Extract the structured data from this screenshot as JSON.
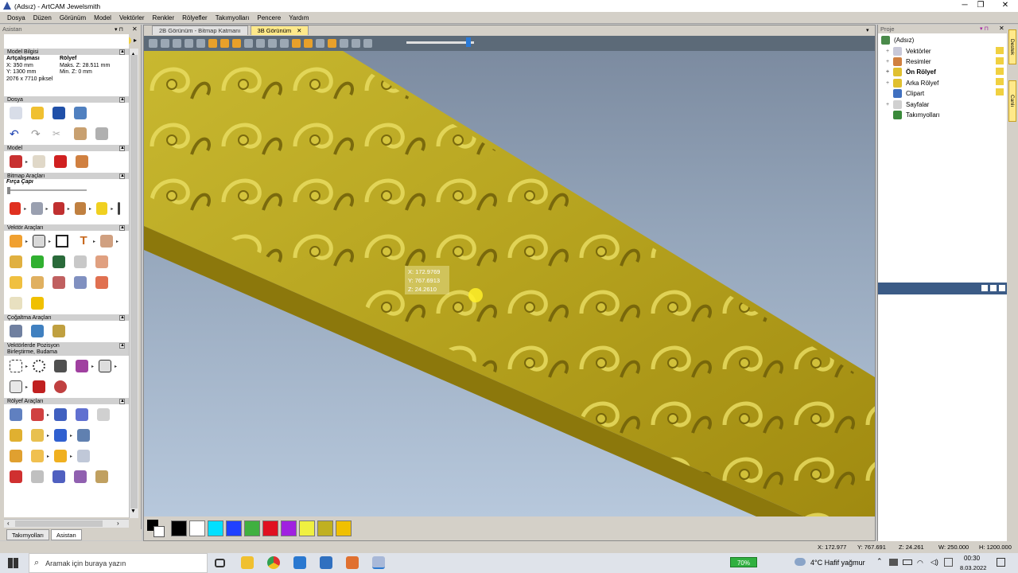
{
  "window": {
    "title": "(Adsız) - ArtCAM Jewelsmith",
    "minimize": "─",
    "maximize": "❐",
    "close": "✕"
  },
  "menu": [
    "Dosya",
    "Düzen",
    "Görünüm",
    "Model",
    "Vektörler",
    "Renkler",
    "Rölyefler",
    "Takımyolları",
    "Pencere",
    "Yardım"
  ],
  "left_panel": {
    "title": "Asistan",
    "model_info": {
      "header": "Model Bilgisi",
      "work_label": "Artçalışması",
      "relief_label": "Rölyef",
      "x": "X: 350 mm",
      "y": "Y: 1300 mm",
      "pixels": "2076 x 7710 piksel",
      "max_z": "Maks. Z: 28.511 mm",
      "min_z": "Min. Z: 0 mm"
    },
    "sections": {
      "file": "Dosya",
      "model": "Model",
      "bitmap": "Bitmap Araçları",
      "brush": "Fırça Çapı",
      "vector": "Vektör Araçları",
      "copy": "Çoğaltma Araçları",
      "position": "Vektörlerde Pozisyon",
      "position2": "Birleştirme, Budama",
      "relief": "Rölyef Araçları"
    }
  },
  "bottom_tabs": [
    "Takımyolları",
    "Asistan"
  ],
  "view_tabs": [
    "2B Görünüm - Bitmap Katmanı",
    "3B Görünüm"
  ],
  "readout": {
    "x": "X: 172.9769",
    "y": "Y: 767.6913",
    "z": "Z: 24.2610"
  },
  "palette_colors": [
    "#000000",
    "#ffffff",
    "#00e0ff",
    "#2040ff",
    "#40b040",
    "#e01020",
    "#a020e0",
    "#f0f040",
    "#c0b020",
    "#f0c000"
  ],
  "right_panel": {
    "title": "Proje",
    "root": "(Adsız)",
    "items": [
      "Vektörler",
      "Resimler",
      "Ön Rölyef",
      "Arka Rölyef",
      "Clipart",
      "Sayfalar",
      "Takımyolları"
    ],
    "side_tabs": [
      "Destek",
      "Canlı"
    ]
  },
  "status": {
    "x": "X: 172.977",
    "y": "Y: 767.691",
    "z": "Z: 24.261",
    "w": "W: 250.000",
    "h": "H: 1200.000"
  },
  "taskbar": {
    "search": "Aramak için buraya yazın",
    "battery": "70%",
    "weather": "4°C  Hafif yağmur",
    "time": "00:30",
    "date": "8.03.2022"
  }
}
